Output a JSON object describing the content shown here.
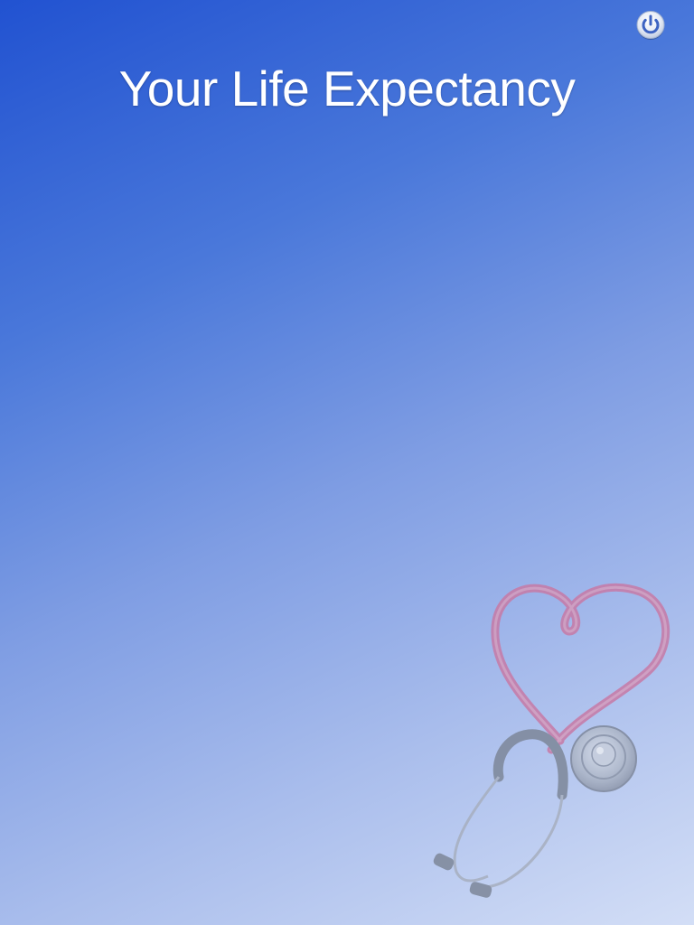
{
  "app": {
    "title": "Your Life Expectancy"
  },
  "toolbar": {
    "power_icon": "power-icon",
    "power_label": "Power"
  },
  "decoration": {
    "illustration": "stethoscope-heart-icon"
  },
  "colors": {
    "background_top": "#2152d1",
    "background_bottom": "#d3def6",
    "title_text": "#ffffff",
    "stethoscope_tube": "#cf7ba4",
    "stethoscope_metal": "#9aa3b4"
  }
}
